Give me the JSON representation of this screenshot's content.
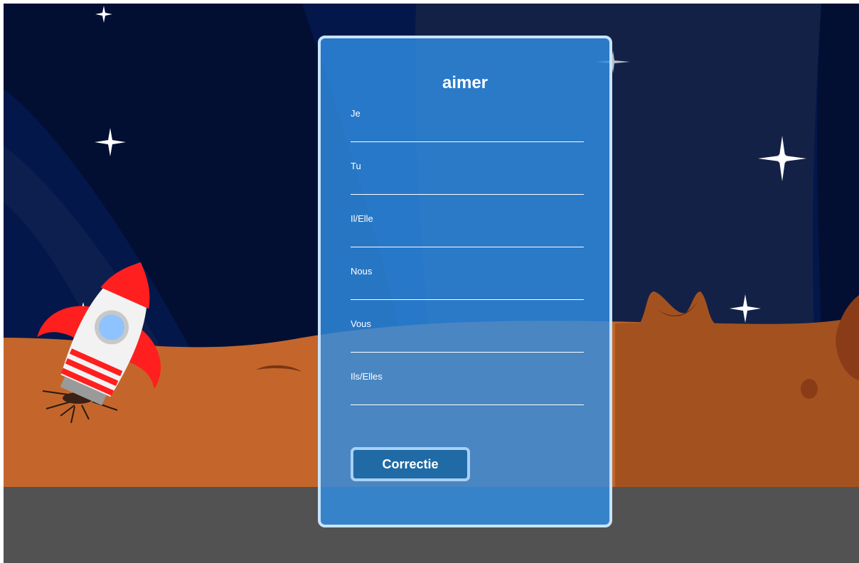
{
  "colors": {
    "sky_dark": "#020f33",
    "sky": "#04174a",
    "ground": "#c4662b",
    "ground_shadow": "#a3521f",
    "road": "#525252",
    "card": "#2f8de4",
    "card_border": "#c9e3fb",
    "button": "#206aa5"
  },
  "icons": {
    "rocket": "rocket-illustration",
    "stars": "star-icon"
  },
  "form": {
    "title": "aimer",
    "fields": [
      {
        "label": "Je",
        "value": ""
      },
      {
        "label": "Tu",
        "value": ""
      },
      {
        "label": "Il/Elle",
        "value": ""
      },
      {
        "label": "Nous",
        "value": ""
      },
      {
        "label": "Vous",
        "value": ""
      },
      {
        "label": "Ils/Elles",
        "value": ""
      }
    ],
    "button_label": "Correctie"
  }
}
